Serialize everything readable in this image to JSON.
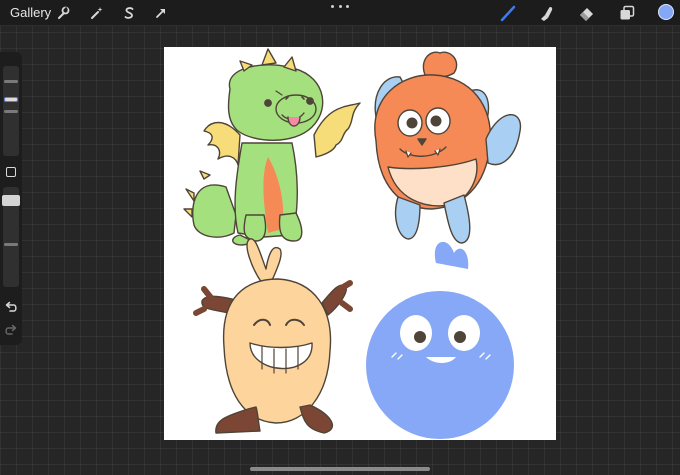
{
  "topbar": {
    "gallery_label": "Gallery",
    "left_tools": [
      "wrench-icon",
      "magic-wand-icon",
      "selection-s-icon",
      "transform-arrow-icon"
    ],
    "right_tools": [
      "brush-icon",
      "smudge-icon",
      "eraser-icon",
      "layers-icon"
    ],
    "active_tool": "brush-icon",
    "active_color": "#84a8f5",
    "accent_color": "#3d7bf0"
  },
  "sidebar": {
    "controls": [
      "brush-size-slider",
      "modify-button",
      "opacity-slider",
      "undo-button",
      "redo-button"
    ]
  },
  "artwork": {
    "characters": [
      "green-dragon",
      "orange-fluffy-monster",
      "grinning-egg-creature",
      "blue-round-bird"
    ],
    "palette": {
      "green": "#a4e07d",
      "orange": "#f58a56",
      "cream": "#fde0c7",
      "blue": "#86a8f6",
      "light_blue": "#a9cff3",
      "yellow": "#f7dc7a",
      "egg": "#fdd49c",
      "brown": "#7b4633",
      "outline": "#4f4438"
    }
  }
}
